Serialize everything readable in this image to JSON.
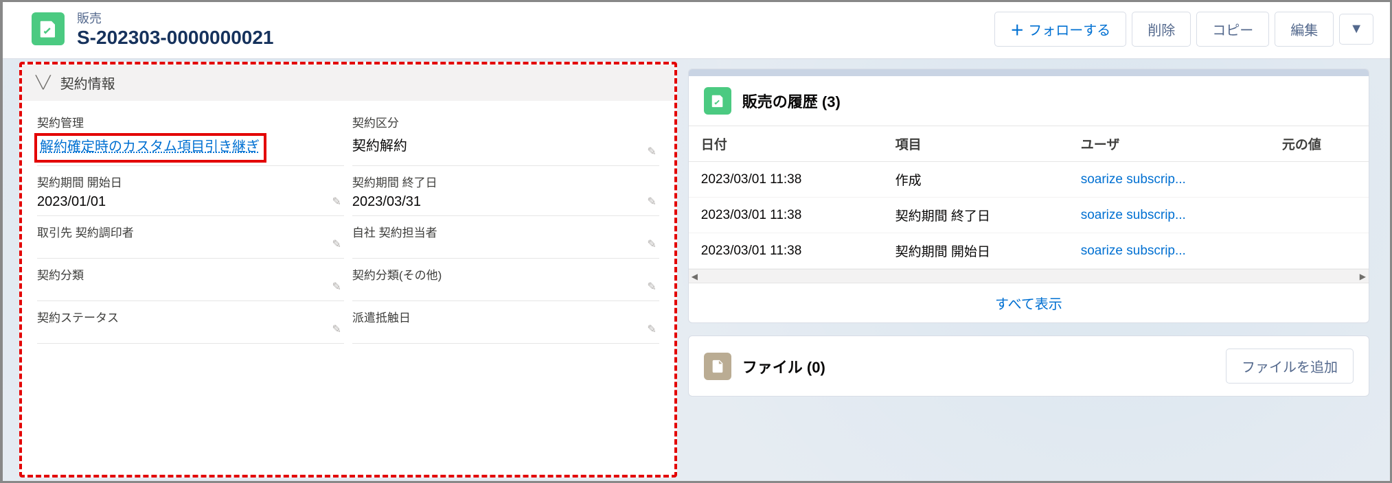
{
  "header": {
    "record_type": "販売",
    "record_name": "S-202303-0000000021",
    "buttons": {
      "follow": "フォローする",
      "delete": "削除",
      "copy": "コピー",
      "edit": "編集"
    }
  },
  "contract_section": {
    "title": "契約情報",
    "fields": {
      "contract_mgmt_label": "契約管理",
      "contract_mgmt_value": "解約確定時のカスタム項目引き継ぎ",
      "contract_div_label": "契約区分",
      "contract_div_value": "契約解約",
      "period_start_label": "契約期間 開始日",
      "period_start_value": "2023/01/01",
      "period_end_label": "契約期間 終了日",
      "period_end_value": "2023/03/31",
      "partner_signer_label": "取引先 契約調印者",
      "partner_signer_value": "",
      "own_signer_label": "自社 契約担当者",
      "own_signer_value": "",
      "category_label": "契約分類",
      "category_value": "",
      "category_other_label": "契約分類(その他)",
      "category_other_value": "",
      "status_label": "契約ステータス",
      "status_value": "",
      "dispatch_label": "派遣抵触日",
      "dispatch_value": ""
    }
  },
  "history_card": {
    "title": "販売の履歴 (3)",
    "columns": {
      "date": "日付",
      "item": "項目",
      "user": "ユーザ",
      "orig": "元の値"
    },
    "rows": [
      {
        "date": "2023/03/01 11:38",
        "item": "作成",
        "user": "soarize subscrip...",
        "orig": ""
      },
      {
        "date": "2023/03/01 11:38",
        "item": "契約期間 終了日",
        "user": "soarize subscrip...",
        "orig": ""
      },
      {
        "date": "2023/03/01 11:38",
        "item": "契約期間 開始日",
        "user": "soarize subscrip...",
        "orig": ""
      }
    ],
    "view_all": "すべて表示"
  },
  "file_card": {
    "title": "ファイル (0)",
    "add_button": "ファイルを追加"
  }
}
